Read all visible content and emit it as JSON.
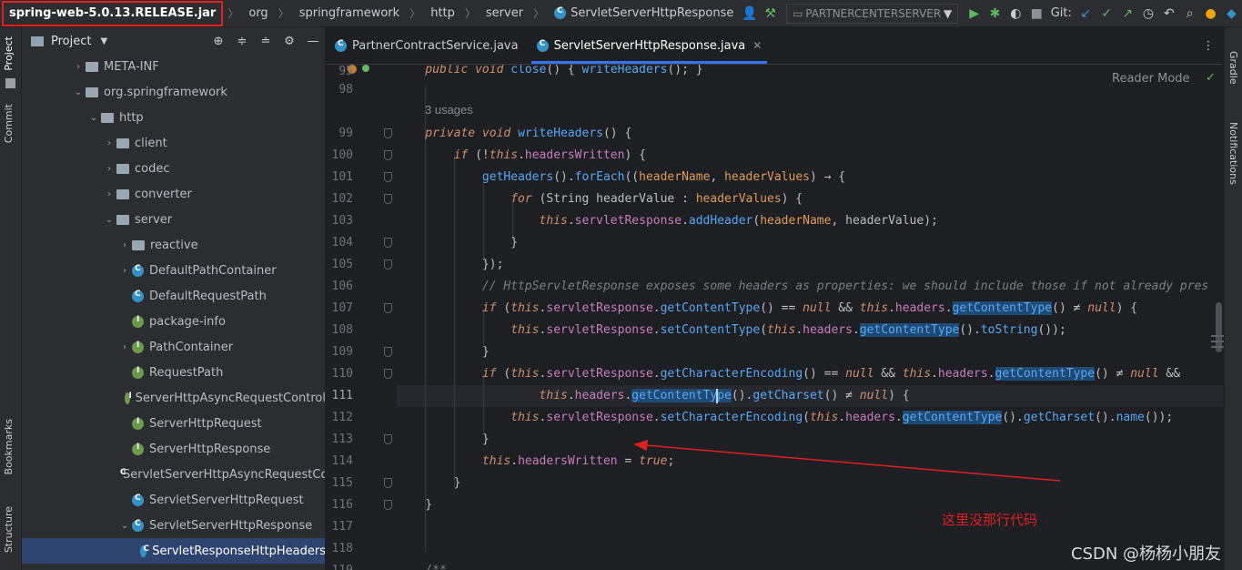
{
  "breadcrumb": {
    "items": [
      "spring-web-5.0.13.RELEASE.jar",
      "org",
      "springframework",
      "http",
      "server",
      "ServletServerHttpResponse"
    ]
  },
  "toolbar": {
    "run_config": "PARTNERCENTERSERVER",
    "git_label": "Git:"
  },
  "left_strip": {
    "project": "Project",
    "commit": "Commit",
    "bookmarks": "Bookmarks",
    "structure": "Structure"
  },
  "right_strip": {
    "gradle": "Gradle",
    "notifications": "Notifications"
  },
  "project_panel": {
    "title": "Project",
    "tree": [
      {
        "label": "META-INF",
        "kind": "folder",
        "expand": "collapsed",
        "depth": 0
      },
      {
        "label": "org.springframework",
        "kind": "folder",
        "expand": "expanded",
        "depth": 0
      },
      {
        "label": "http",
        "kind": "folder",
        "expand": "expanded",
        "depth": 1
      },
      {
        "label": "client",
        "kind": "folder",
        "expand": "collapsed",
        "depth": 2
      },
      {
        "label": "codec",
        "kind": "folder",
        "expand": "collapsed",
        "depth": 2
      },
      {
        "label": "converter",
        "kind": "folder",
        "expand": "collapsed",
        "depth": 2
      },
      {
        "label": "server",
        "kind": "folder",
        "expand": "expanded",
        "depth": 2
      },
      {
        "label": "reactive",
        "kind": "folder",
        "expand": "collapsed",
        "depth": 3
      },
      {
        "label": "DefaultPathContainer",
        "kind": "class",
        "expand": "collapsed",
        "depth": 3
      },
      {
        "label": "DefaultRequestPath",
        "kind": "class",
        "expand": "none",
        "depth": 3
      },
      {
        "label": "package-info",
        "kind": "interface",
        "expand": "none",
        "depth": 3
      },
      {
        "label": "PathContainer",
        "kind": "interface",
        "expand": "collapsed",
        "depth": 3
      },
      {
        "label": "RequestPath",
        "kind": "interface",
        "expand": "none",
        "depth": 3
      },
      {
        "label": "ServerHttpAsyncRequestControl",
        "kind": "interface",
        "expand": "none",
        "depth": 3
      },
      {
        "label": "ServerHttpRequest",
        "kind": "interface",
        "expand": "none",
        "depth": 3
      },
      {
        "label": "ServerHttpResponse",
        "kind": "interface",
        "expand": "none",
        "depth": 3
      },
      {
        "label": "ServletServerHttpAsyncRequestControl",
        "kind": "class",
        "expand": "none",
        "depth": 3
      },
      {
        "label": "ServletServerHttpRequest",
        "kind": "class",
        "expand": "none",
        "depth": 3
      },
      {
        "label": "ServletServerHttpResponse",
        "kind": "class",
        "expand": "expanded",
        "depth": 3
      },
      {
        "label": "ServletResponseHttpHeaders",
        "kind": "class",
        "expand": "none",
        "depth": 4,
        "selected": true
      }
    ]
  },
  "tabs": [
    {
      "label": "PartnerContractService.java",
      "active": false
    },
    {
      "label": "ServletServerHttpResponse.java",
      "active": true
    }
  ],
  "editor": {
    "reader_mode": "Reader Mode",
    "usages": "3 usages",
    "line_numbers": [
      "95",
      "98",
      "",
      "99",
      "100",
      "101",
      "102",
      "103",
      "104",
      "105",
      "106",
      "107",
      "108",
      "109",
      "110",
      "111",
      "112",
      "113",
      "114",
      "115",
      "116",
      "117",
      "118",
      "119"
    ],
    "current_line": "111"
  },
  "annotation": {
    "text": "这里没那行代码",
    "color": "#e02020"
  },
  "watermark": "CSDN @杨杨小朋友",
  "colors": {
    "accent": "#3574f0",
    "keyword": "#cf8e6d",
    "function": "#56a8f5",
    "parameter": "#e09b5a",
    "member": "#c77dbb",
    "annotation_red": "#e02020"
  }
}
